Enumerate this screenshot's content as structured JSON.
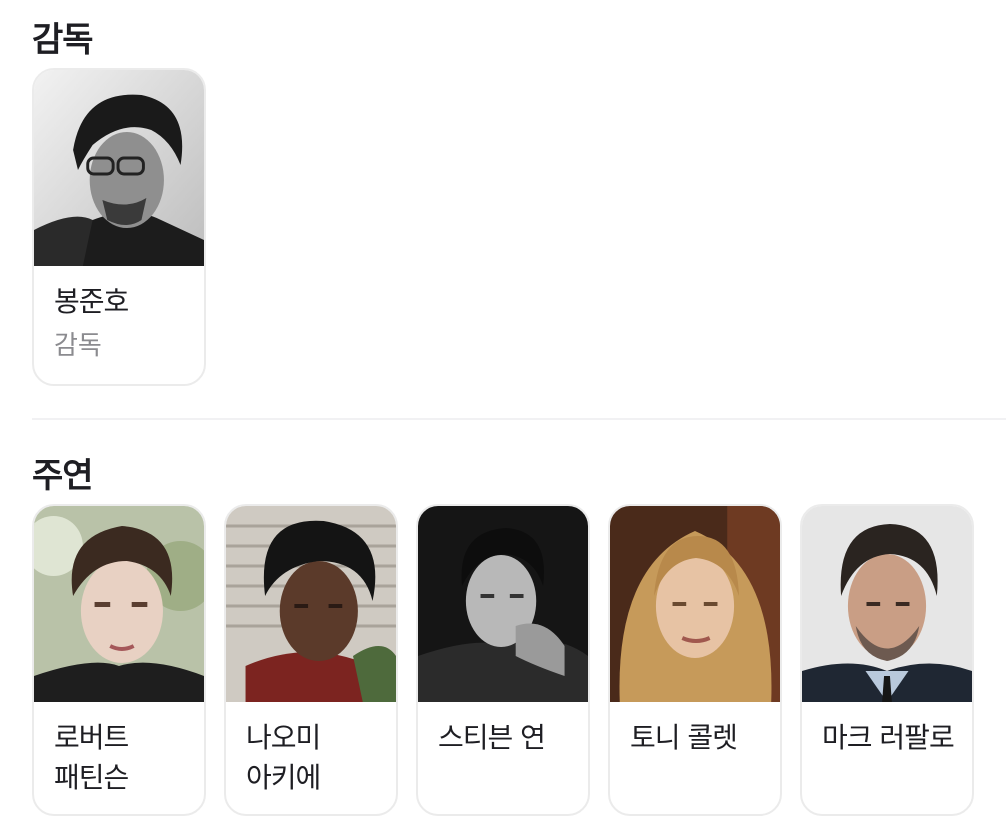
{
  "director_section": {
    "title": "감독",
    "people": [
      {
        "name": "봉준호",
        "role": "감독",
        "photo_icon": "person-photo-director"
      }
    ]
  },
  "cast_section": {
    "title": "주연",
    "people": [
      {
        "name": "로버트 패틴슨",
        "photo_icon": "person-photo-robert-pattinson"
      },
      {
        "name": "나오미 아키에",
        "photo_icon": "person-photo-naomi-ackie"
      },
      {
        "name": "스티븐 연",
        "photo_icon": "person-photo-steven-yeun"
      },
      {
        "name": "토니 콜렛",
        "photo_icon": "person-photo-toni-collette"
      },
      {
        "name": "마크 러팔로",
        "photo_icon": "person-photo-mark-ruffalo"
      }
    ]
  }
}
